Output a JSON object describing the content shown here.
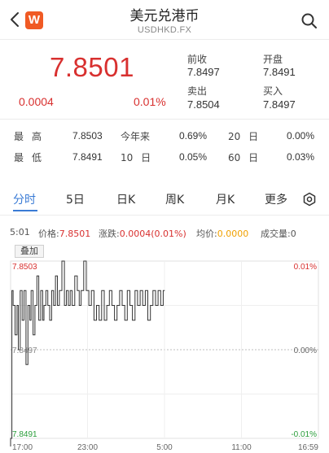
{
  "header": {
    "title": "美元兑港币",
    "subtitle": "USDHKD.FX",
    "logo_text": "W"
  },
  "quote": {
    "price": "7.8501",
    "change": "0.0004",
    "change_pct": "0.01%",
    "prev_close_label": "前收",
    "prev_close": "7.8497",
    "open_label": "开盘",
    "open": "7.8491",
    "ask_label": "卖出",
    "ask": "7.8504",
    "bid_label": "买入",
    "bid": "7.8497"
  },
  "stats": {
    "high_label": "最高",
    "high": "7.8503",
    "low_label": "最低",
    "low": "7.8491",
    "ytd_label": "今年来",
    "ytd": "0.69%",
    "d10_label": "10 日",
    "d10": "0.05%",
    "d20_label": "20 日",
    "d20": "0.00%",
    "d60_label": "60 日",
    "d60": "0.03%"
  },
  "tabs": [
    "分时",
    "5日",
    "日K",
    "周K",
    "月K",
    "更多"
  ],
  "info": {
    "time": "5:01",
    "price_label": "价格:",
    "price": "7.8501",
    "change_label": "涨跌:",
    "change": "0.0004(0.01%)",
    "avg_label": "均价:",
    "avg": "0.0000",
    "volume_label": "成交量:",
    "volume": "0"
  },
  "overlay_button": "叠加",
  "colors": {
    "up": "#d8302f",
    "down": "#2a9d3a",
    "accent": "#3a7bd5",
    "avg": "#f0a000"
  },
  "chart_data": {
    "type": "line",
    "y_axis_left": [
      "7.8503",
      "7.8497",
      "7.8491"
    ],
    "y_axis_right": [
      "0.01%",
      "0.00%",
      "-0.01%"
    ],
    "x_ticks": [
      "17:00",
      "23:00",
      "5:00",
      "11:00",
      "16:59"
    ],
    "ylim": [
      7.8491,
      7.8503
    ],
    "series": [
      {
        "x": [
          17.0,
          17.1,
          17.2,
          17.35,
          17.5,
          17.6,
          17.75,
          17.9,
          18.05,
          18.2,
          18.35,
          18.5,
          18.6,
          18.75,
          18.9,
          19.05,
          19.2,
          19.35,
          19.5,
          19.6,
          19.75,
          19.9,
          20.05,
          20.2,
          20.35,
          20.5,
          20.65,
          20.8,
          21.0,
          21.2,
          21.35,
          21.5,
          21.65,
          21.8,
          22.0,
          22.2,
          22.35,
          22.5,
          22.7,
          22.9,
          23.1,
          23.3,
          23.5,
          23.7,
          23.9,
          24.1,
          24.3,
          24.5,
          24.7,
          24.9,
          25.1,
          25.3,
          25.5,
          25.7,
          25.9,
          26.1,
          26.3,
          26.5,
          26.7,
          26.9,
          27.1,
          27.3,
          27.5,
          27.7,
          27.9,
          28.1,
          28.3,
          28.5,
          28.7,
          28.9,
          29.02
        ],
        "y": [
          7.8491,
          7.8501,
          7.85,
          7.8498,
          7.85,
          7.8497,
          7.8501,
          7.8499,
          7.8501,
          7.8496,
          7.85,
          7.8499,
          7.8501,
          7.8498,
          7.85,
          7.8502,
          7.8499,
          7.8501,
          7.8499,
          7.85,
          7.8501,
          7.85,
          7.8499,
          7.8501,
          7.85,
          7.8502,
          7.85,
          7.8501,
          7.8503,
          7.85,
          7.8501,
          7.85,
          7.8501,
          7.85,
          7.8502,
          7.8501,
          7.85,
          7.8501,
          7.8503,
          7.8501,
          7.85,
          7.8501,
          7.8499,
          7.85,
          7.8499,
          7.8501,
          7.8499,
          7.85,
          7.8501,
          7.85,
          7.8499,
          7.85,
          7.8501,
          7.85,
          7.8499,
          7.8501,
          7.85,
          7.8499,
          7.8501,
          7.85,
          7.8501,
          7.85,
          7.8501,
          7.8499,
          7.85,
          7.8501,
          7.85,
          7.8501,
          7.85,
          7.8501,
          7.8501
        ]
      }
    ]
  }
}
